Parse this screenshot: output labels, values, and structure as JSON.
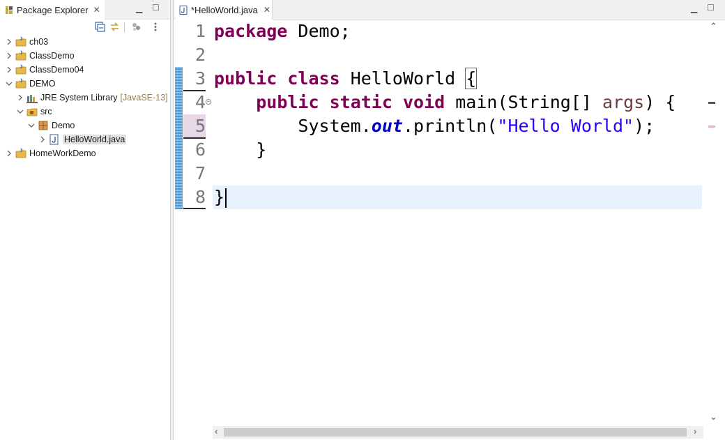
{
  "package_explorer": {
    "title": "Package Explorer",
    "tree": [
      {
        "label": "ch03",
        "decoration": ""
      },
      {
        "label": "ClassDemo",
        "decoration": ""
      },
      {
        "label": "ClassDemo04",
        "decoration": ""
      },
      {
        "label": "DEMO",
        "decoration": ""
      },
      {
        "label": "JRE System Library",
        "decoration": "[JavaSE-13]"
      },
      {
        "label": "src",
        "decoration": ""
      },
      {
        "label": "Demo",
        "decoration": ""
      },
      {
        "label": "HelloWorld.java",
        "decoration": ""
      },
      {
        "label": "HomeWorkDemo",
        "decoration": ""
      }
    ]
  },
  "editor": {
    "tab_label": "*HelloWorld.java",
    "line_numbers": [
      "1",
      "2",
      "3",
      "4",
      "5",
      "6",
      "7",
      "8"
    ],
    "tokens": {
      "l1_kw": "package",
      "l1_rest": " Demo;",
      "l3_kw1": "public",
      "l3_kw2": "class",
      "l3_name": " HelloWorld ",
      "l3_brace": "{",
      "l4_kw1": "public",
      "l4_kw2": "static",
      "l4_kw3": "void",
      "l4_sig": " main(String[] ",
      "l4_param": "args",
      "l4_end": ") {",
      "l5_a": "System.",
      "l5_field": "out",
      "l5_b": ".println(",
      "l5_str": "\"Hello World\"",
      "l5_c": ");",
      "l6": "}",
      "l8": "}"
    }
  },
  "colors": {
    "keyword": "#7f0055",
    "string": "#2a00ff",
    "field": "#0000c0",
    "parameter": "#6a3e3e",
    "current_line": "#e8f2fe",
    "diff_bar": "#4b97d2"
  }
}
